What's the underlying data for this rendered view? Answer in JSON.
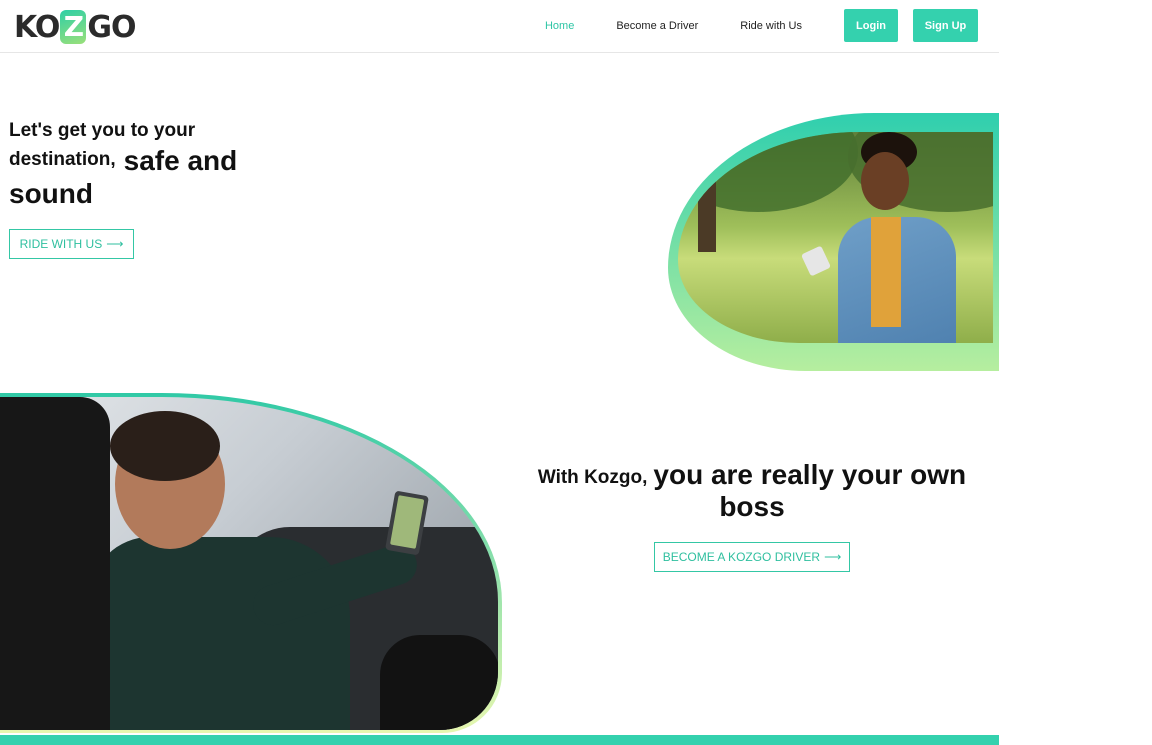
{
  "brand": {
    "logo_prefix": "KO",
    "logo_z": "Z",
    "logo_suffix": "GO",
    "accent": "#34d1ae",
    "gradient_end": "#b6ee9f"
  },
  "nav": {
    "items": [
      {
        "label": "Home",
        "active": true
      },
      {
        "label": "Become a Driver",
        "active": false
      },
      {
        "label": "Ride with Us",
        "active": false
      }
    ],
    "login_label": "Login",
    "signup_label": "Sign Up"
  },
  "hero": {
    "line1": "Let's get you to your",
    "line2_small": "destination,",
    "line2_big": "safe and",
    "line3_big": "sound",
    "cta_label": "RIDE WITH US",
    "cta_icon": "arrow-right-icon"
  },
  "driver_section": {
    "line1_small": "With Kozgo,",
    "line1_big": "you are really your own",
    "line2_big": "boss",
    "cta_label": "BECOME A KOZGO DRIVER",
    "cta_icon": "arrow-right-icon"
  },
  "icons": {
    "arrow": "⟶"
  }
}
